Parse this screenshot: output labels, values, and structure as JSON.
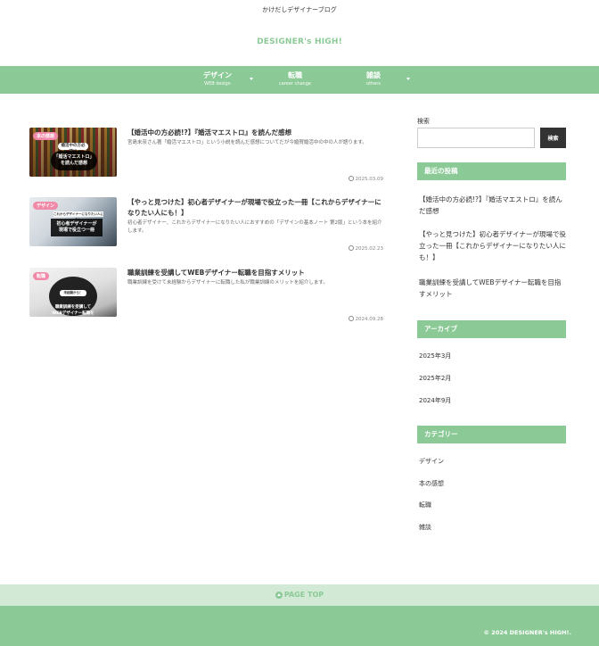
{
  "header": {
    "tagline": "かけだしデザイナーブログ",
    "logo": "DESIGNER's HIGH!"
  },
  "nav": [
    {
      "label": "デザイン",
      "sub": "WEB design",
      "has_dropdown": true
    },
    {
      "label": "転職",
      "sub": "career change",
      "has_dropdown": false
    },
    {
      "label": "雑談",
      "sub": "others",
      "has_dropdown": true
    }
  ],
  "posts": [
    {
      "category": "本の感想",
      "thumb_badge_top": "婚活中の方必読!?",
      "thumb_badge": "「婚活マエストロ」\nを読んだ感想",
      "title": "【婚活中の方必読!?】『婚活マエストロ』を読んだ感想",
      "excerpt": "宮島未奈さん著「婚活マエストロ」という小説を読んだ感想についてだが今婚賀婚活中の中の人が語ります。",
      "date": "2025.03.09"
    },
    {
      "category": "デザイン",
      "thumb_badge_top": "これからデザイナーになりたい人にも！",
      "thumb_badge": "初心者デザイナーが\n現場で役立つ一冊",
      "title": "【やっと見つけた】初心者デザイナーが現場で役立った一冊【これからデザイナーになりたい人にも！】",
      "excerpt": "初心者デザイナー、これからデザイナーになりたい人におすすめの「デザインの基本ノート 第2版」という本を紹介します。",
      "date": "2025.02.23"
    },
    {
      "category": "転職",
      "thumb_badge_top": "未経験から！",
      "thumb_badge": "職業訓練を受講して\nWEBデザイナー転職を\n目指すメリット",
      "title": "職業訓練を受講してWEBデザイナー転職を目指すメリット",
      "excerpt": "職業訓練を受けて未経験からデザイナーに転職した私が職業訓練のメリットを紹介します。",
      "date": "2024.09.28"
    }
  ],
  "sidebar": {
    "search_label": "検索",
    "search_value": "",
    "search_button": "検索",
    "recent_title": "最近の投稿",
    "recent": [
      "【婚活中の方必読!?】『婚活マエストロ』を読んだ感想",
      "【やっと見つけた】初心者デザイナーが現場で役立った一冊【これからデザイナーになりたい人にも！】",
      "職業訓練を受講してWEBデザイナー転職を目指すメリット"
    ],
    "archive_title": "アーカイブ",
    "archives": [
      "2025年3月",
      "2025年2月",
      "2024年9月"
    ],
    "category_title": "カテゴリー",
    "categories": [
      "デザイン",
      "本の感想",
      "転職",
      "雑談"
    ]
  },
  "footer": {
    "pagetop": "PAGE TOP",
    "copyright": "© 2024 DESIGNER's HIGH!."
  },
  "colors": {
    "accent": "#8bca96",
    "accent_light": "#d1e9d5",
    "dark": "#333333",
    "tag_pink": "#f08aa8"
  }
}
